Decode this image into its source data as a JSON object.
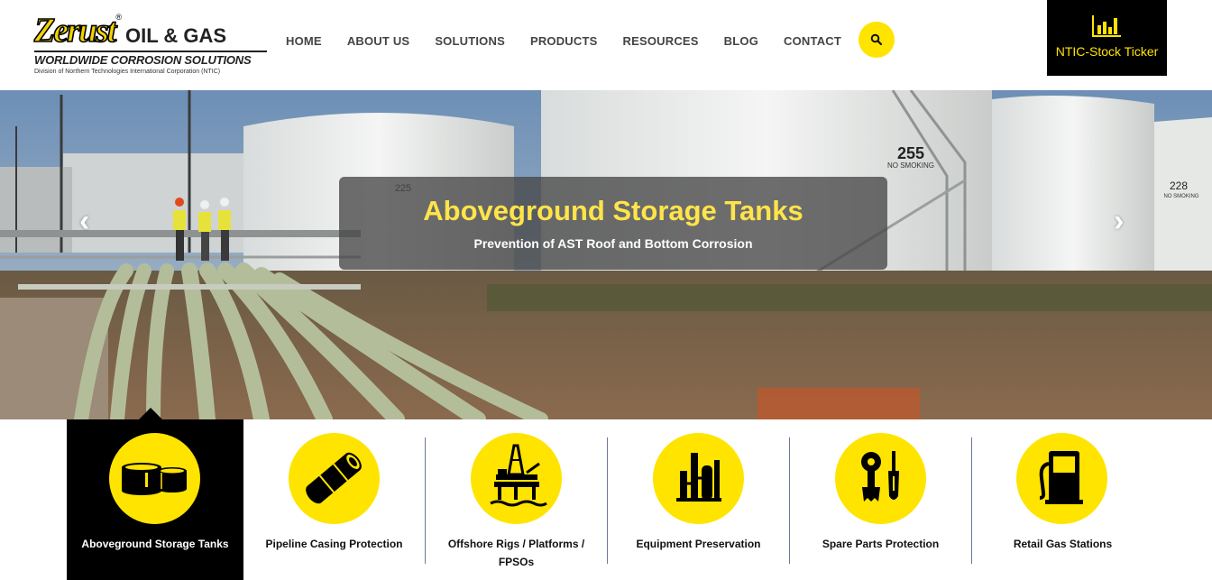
{
  "header": {
    "logo": {
      "brand": "Zerust",
      "reg": "®",
      "division_name": "OIL & GAS",
      "tagline": "WORLDWIDE CORROSION SOLUTIONS",
      "subline": "Division of Northern Technologies International Corporation (NTIC)"
    },
    "nav": [
      "HOME",
      "ABOUT US",
      "SOLUTIONS",
      "PRODUCTS",
      "RESOURCES",
      "BLOG",
      "CONTACT"
    ],
    "search_icon": "search-icon",
    "ticker": {
      "label": "NTIC-Stock Ticker",
      "icon": "bar-chart-icon"
    }
  },
  "hero": {
    "title": "Aboveground Storage Tanks",
    "subtitle": "Prevention of AST Roof and Bottom Corrosion",
    "tank_labels": [
      "225",
      "255",
      "NO SMOKING",
      "228",
      "NO SMOKING"
    ],
    "prev_icon": "chevron-left-icon",
    "next_icon": "chevron-right-icon"
  },
  "categories": [
    {
      "label": "Aboveground Storage Tanks",
      "icon": "storage-tank-icon",
      "active": true
    },
    {
      "label": "Pipeline Casing Protection",
      "icon": "pipeline-icon",
      "active": false
    },
    {
      "label": "Offshore Rigs / Platforms / FPSOs",
      "icon": "offshore-rig-icon",
      "active": false
    },
    {
      "label": "Equipment Preservation",
      "icon": "refinery-icon",
      "active": false
    },
    {
      "label": "Spare Parts Protection",
      "icon": "tools-icon",
      "active": false
    },
    {
      "label": "Retail Gas Stations",
      "icon": "gas-pump-icon",
      "active": false
    }
  ],
  "colors": {
    "accent": "#ffe400",
    "dark": "#000000",
    "caption_text": "#ffe44a",
    "nav_text": "#444444"
  }
}
